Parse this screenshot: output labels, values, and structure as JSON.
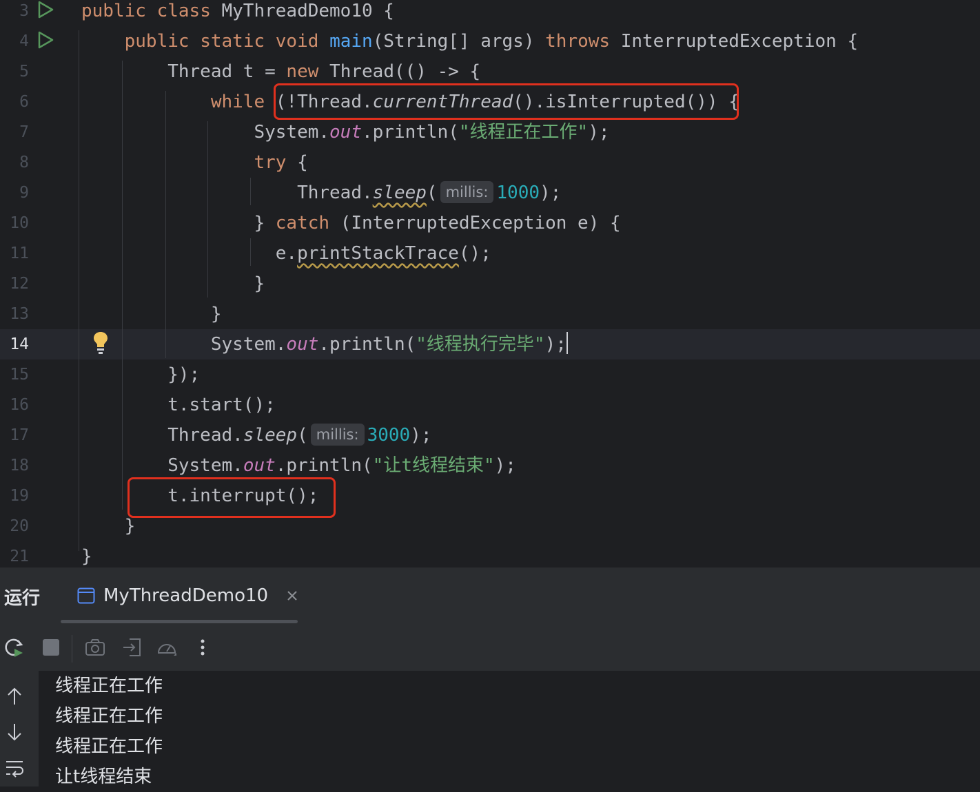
{
  "editor": {
    "lines": [
      {
        "n": "3",
        "tokens": [
          [
            "kw",
            "public "
          ],
          [
            "kw",
            "class "
          ],
          [
            "",
            "MyThreadDemo10 {"
          ]
        ]
      },
      {
        "n": "4",
        "tokens": [
          [
            "",
            "    "
          ],
          [
            "kw",
            "public "
          ],
          [
            "kw",
            "static "
          ],
          [
            "kw",
            "void "
          ],
          [
            "fn",
            "main"
          ],
          [
            "",
            "(String[] args) "
          ],
          [
            "kw",
            "throws "
          ],
          [
            "",
            "InterruptedException {"
          ]
        ]
      },
      {
        "n": "5",
        "tokens": [
          [
            "",
            "        Thread t = "
          ],
          [
            "kw",
            "new "
          ],
          [
            "",
            "Thread(() -> {"
          ]
        ]
      },
      {
        "n": "6",
        "tokens": [
          [
            "",
            "            "
          ],
          [
            "kw",
            "while "
          ],
          [
            "",
            "(!Thread."
          ],
          [
            "it",
            "currentThread"
          ],
          [
            "",
            "().isInterrupted()) {"
          ]
        ]
      },
      {
        "n": "7",
        "tokens": [
          [
            "",
            "                System."
          ],
          [
            "fld",
            "out"
          ],
          [
            "",
            ".println("
          ],
          [
            "str",
            "\"线程正在工作\""
          ],
          [
            "",
            ");"
          ]
        ]
      },
      {
        "n": "8",
        "tokens": [
          [
            "",
            "                "
          ],
          [
            "kw",
            "try "
          ],
          [
            "",
            "{"
          ]
        ]
      },
      {
        "n": "9",
        "tokens": [
          [
            "",
            "                    Thread."
          ],
          [
            "itw",
            "sleep"
          ],
          [
            "",
            "("
          ],
          [
            "hint",
            "millis:"
          ],
          [
            "num",
            "1000"
          ],
          [
            "",
            ");"
          ]
        ]
      },
      {
        "n": "10",
        "tokens": [
          [
            "",
            "                } "
          ],
          [
            "kw",
            "catch "
          ],
          [
            "",
            "(InterruptedException e) {"
          ]
        ]
      },
      {
        "n": "11",
        "tokens": [
          [
            "",
            "                  e."
          ],
          [
            "wavy",
            "printStackTrace"
          ],
          [
            "",
            "();"
          ]
        ]
      },
      {
        "n": "12",
        "tokens": [
          [
            "",
            "                }"
          ]
        ]
      },
      {
        "n": "13",
        "tokens": [
          [
            "",
            "            }"
          ]
        ]
      },
      {
        "n": "14",
        "current": true,
        "tokens": [
          [
            "",
            "            System."
          ],
          [
            "fld",
            "out"
          ],
          [
            "",
            ".println("
          ],
          [
            "str",
            "\"线程执行完毕\""
          ],
          [
            "",
            ");"
          ],
          [
            "caret",
            ""
          ]
        ]
      },
      {
        "n": "15",
        "tokens": [
          [
            "",
            "        });"
          ]
        ]
      },
      {
        "n": "16",
        "tokens": [
          [
            "",
            "        t.start();"
          ]
        ]
      },
      {
        "n": "17",
        "tokens": [
          [
            "",
            "        Thread."
          ],
          [
            "it",
            "sleep"
          ],
          [
            "",
            "("
          ],
          [
            "hint",
            "millis:"
          ],
          [
            "num",
            "3000"
          ],
          [
            "",
            ");"
          ]
        ]
      },
      {
        "n": "18",
        "tokens": [
          [
            "",
            "        System."
          ],
          [
            "fld",
            "out"
          ],
          [
            "",
            ".println("
          ],
          [
            "str",
            "\"让t线程结束\""
          ],
          [
            "",
            ");"
          ]
        ]
      },
      {
        "n": "19",
        "tokens": [
          [
            "",
            "        t.interrupt();"
          ]
        ]
      },
      {
        "n": "20",
        "tokens": [
          [
            "",
            "    }"
          ]
        ]
      },
      {
        "n": "21",
        "tokens": [
          [
            "",
            "}"
          ]
        ]
      }
    ]
  },
  "run_panel": {
    "title": "运行",
    "tab_label": "MyThreadDemo10"
  },
  "console": {
    "output": [
      "线程正在工作",
      "线程正在工作",
      "线程正在工作",
      "让t线程结束"
    ]
  }
}
